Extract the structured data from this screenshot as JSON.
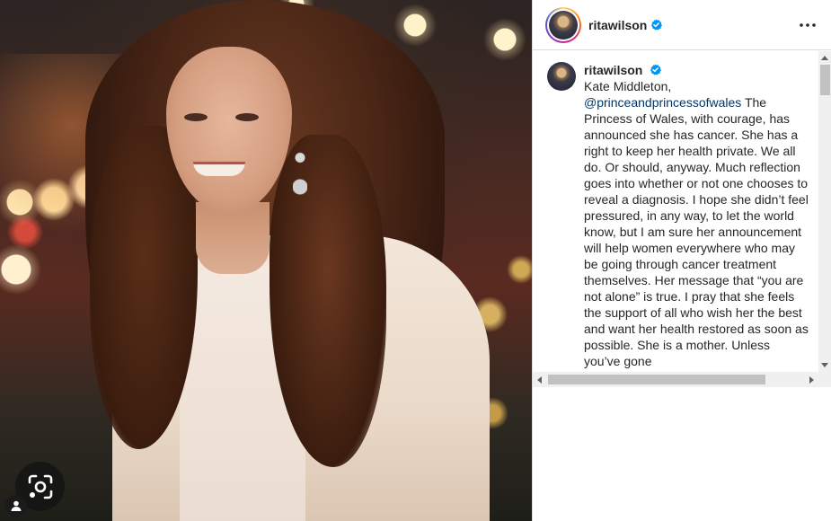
{
  "post": {
    "username": "ritawilson",
    "verified": true,
    "more_icon": "more-horizontal-icon"
  },
  "caption": {
    "username": "ritawilson",
    "line1": "Kate Middleton,",
    "mention": "@princeandprincessofwales",
    "text": " The Princess of Wales, with courage, has announced she has cancer. She has a right to keep her health private. We all do. Or should, anyway. Much reflection goes into whether or not one chooses to reveal a diagnosis. I hope she didn’t feel pressured, in any way, to let the world know, but I am sure her announcement will help women everywhere who may be going through cancer treatment themselves. Her message that “you are not alone” is true. I pray that she feels the support of all who wish her the best and want her health restored as soon as possible. She is a mother. Unless you’ve gone"
  },
  "overlay": {
    "lens_icon": "camera-search-icon",
    "person_icon": "person-icon"
  },
  "colors": {
    "verified": "#0095f6",
    "mention": "#00376b",
    "border": "#dbdbdb"
  }
}
